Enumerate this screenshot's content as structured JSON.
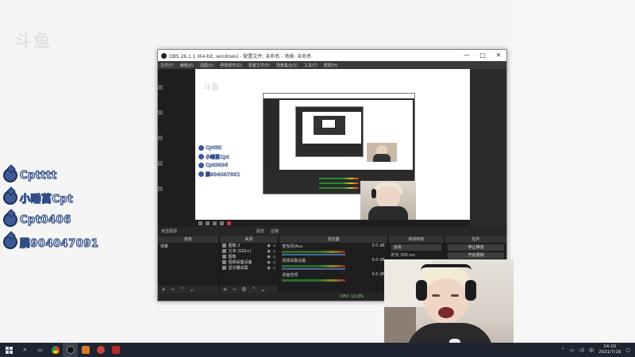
{
  "watermark": "斗鱼",
  "overlay_names": [
    "Cptttt",
    "小睡莒Cpt",
    "Cpt0406",
    "鹏904047091"
  ],
  "obs": {
    "title": "OBS 26.1.1 (64-bit, windows) - 配置文件: 未命名 - 场景: 未命名",
    "window_controls": [
      "—",
      "□",
      "✕"
    ],
    "menu": [
      "文件(F)",
      "编辑(E)",
      "视图(V)",
      "停靠部件(D)",
      "配置文件(P)",
      "场景集合(S)",
      "工具(T)",
      "帮助(H)"
    ],
    "preview_names": [
      "Cptttt",
      "小睡莒Cpt",
      "Cpt0406",
      "鹏904047091"
    ],
    "bottom_bar": {
      "left": "未选择源",
      "props": "属性",
      "filters": "滤镜"
    },
    "docks": {
      "scenes": {
        "title": "场景",
        "items": [
          "场景"
        ]
      },
      "sources": {
        "title": "来源",
        "items": [
          "图像 2",
          "文本 (GDI+)",
          "图像",
          "视频采集设备",
          "显示器采集"
        ]
      },
      "mixer": {
        "title": "混音器",
        "rows": [
          {
            "name": "麦克风/Aux",
            "db": "0.0 dB"
          },
          {
            "name": "视频采集设备",
            "db": "0.0 dB"
          },
          {
            "name": "桌面音频",
            "db": "0.0 dB"
          }
        ]
      },
      "transitions": {
        "title": "转场特效",
        "type": "淡出",
        "duration_label": "时长",
        "duration": "300 ms"
      },
      "controls": {
        "title": "控件",
        "buttons": [
          "停止推流",
          "开始录制"
        ]
      }
    },
    "status": "CPU: 12.0%"
  },
  "taskbar": {
    "time": "14:10",
    "date": "2021/7/16",
    "apps": [
      {
        "name": "search",
        "color": "#1f2530"
      },
      {
        "name": "taskview",
        "color": "#1f2530"
      },
      {
        "name": "chrome",
        "color": "#e0a020"
      },
      {
        "name": "obs",
        "color": "#222222"
      },
      {
        "name": "app-orange",
        "color": "#d87a2a"
      },
      {
        "name": "app-red",
        "color": "#c8443a"
      },
      {
        "name": "app-darkred",
        "color": "#b02a2a"
      }
    ]
  }
}
